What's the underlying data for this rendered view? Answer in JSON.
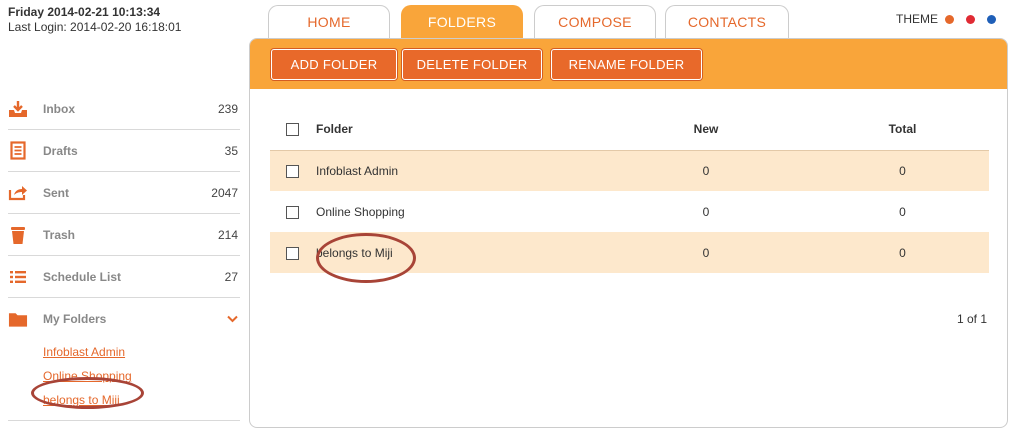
{
  "header": {
    "date": "Friday 2014-02-21 10:13:34",
    "last_login": "Last Login: 2014-02-20 16:18:01"
  },
  "tabs": [
    {
      "label": "HOME",
      "active": false
    },
    {
      "label": "FOLDERS",
      "active": true
    },
    {
      "label": "COMPOSE",
      "active": false
    },
    {
      "label": "CONTACTS",
      "active": false
    }
  ],
  "theme": {
    "label": "THEME",
    "colors": [
      "#e5682b",
      "#e02b34",
      "#1f5fb8"
    ]
  },
  "sidebar": {
    "items": [
      {
        "label": "Inbox",
        "count": "239",
        "icon": "inbox-icon"
      },
      {
        "label": "Drafts",
        "count": "35",
        "icon": "drafts-icon"
      },
      {
        "label": "Sent",
        "count": "2047",
        "icon": "sent-icon"
      },
      {
        "label": "Trash",
        "count": "214",
        "icon": "trash-icon"
      },
      {
        "label": "Schedule List",
        "count": "27",
        "icon": "list-icon"
      }
    ],
    "my_folders": {
      "label": "My Folders",
      "links": [
        "Infoblast Admin",
        "Online Shopping",
        "belongs to Miji"
      ]
    }
  },
  "toolbar": {
    "add": "ADD FOLDER",
    "delete": "DELETE FOLDER",
    "rename": "RENAME FOLDER"
  },
  "table": {
    "headers": {
      "folder": "Folder",
      "new": "New",
      "total": "Total"
    },
    "rows": [
      {
        "folder": "Infoblast Admin",
        "new": "0",
        "total": "0"
      },
      {
        "folder": "Online Shopping",
        "new": "0",
        "total": "0"
      },
      {
        "folder": "belongs to Miji",
        "new": "0",
        "total": "0"
      }
    ]
  },
  "pager": "1 of 1",
  "colors": {
    "accent": "#f9a53a",
    "button": "#e8692a",
    "link": "#e5682b",
    "highlight_circle": "#a84437"
  }
}
